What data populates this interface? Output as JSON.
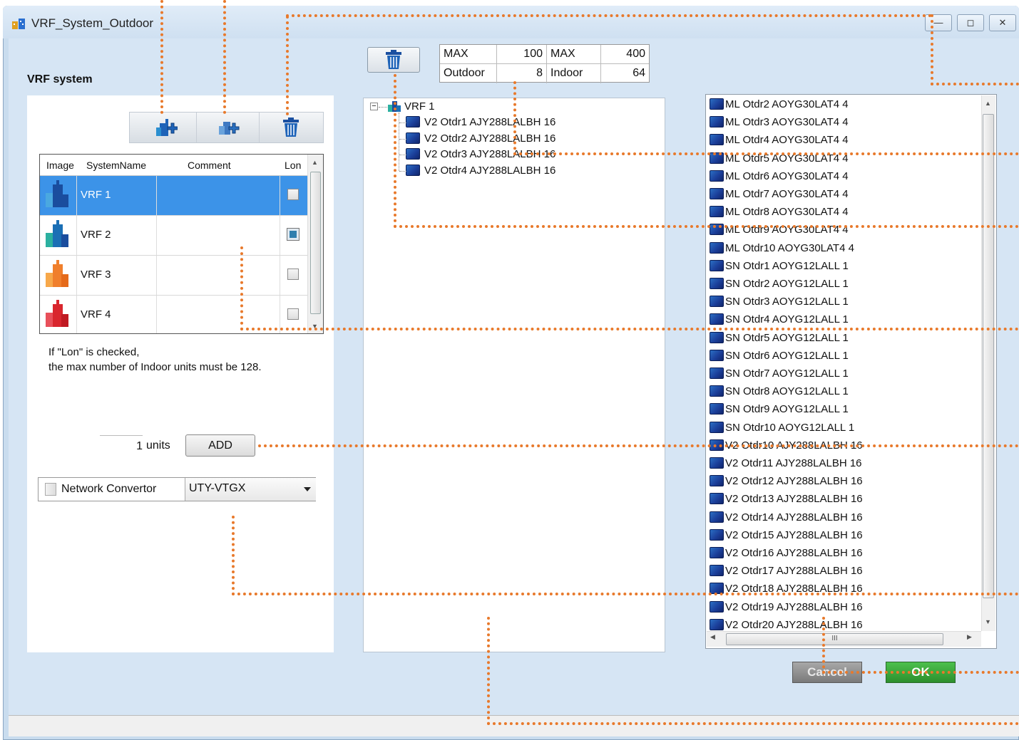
{
  "window": {
    "title": "VRF_System_Outdoor",
    "min_label": "—",
    "max_label": "◻",
    "close_label": "✕"
  },
  "left": {
    "section_label": "VRF system",
    "grid": {
      "headers": [
        "Image",
        "SystemName",
        "Comment",
        "Lon"
      ],
      "rows": [
        {
          "name": "VRF 1",
          "color": "#1a4d9e",
          "checked": false,
          "selected": true
        },
        {
          "name": "VRF 2",
          "color": "#1b6fb5",
          "checked": true,
          "selected": false
        },
        {
          "name": "VRF 3",
          "color": "#f07f2c",
          "checked": false,
          "selected": false
        },
        {
          "name": "VRF 4",
          "color": "#d9262e",
          "checked": false,
          "selected": false
        }
      ]
    },
    "note_line1": "If \"Lon\" is checked,",
    "note_line2": "the max number of Indoor units must be 128.",
    "units_value": "1",
    "units_label": "units",
    "add_label": "ADD",
    "network_label": "Network Convertor",
    "network_value": "UTY-VTGX"
  },
  "max_table": {
    "max1": "MAX",
    "max1_value": "100",
    "max2": "MAX",
    "max2_value": "400",
    "outdoor": "Outdoor",
    "outdoor_value": "8",
    "indoor": "Indoor",
    "indoor_value": "64"
  },
  "tree": {
    "root": "VRF 1",
    "children": [
      "V2  Otdr1  AJY288LALBH  16",
      "V2  Otdr2  AJY288LALBH  16",
      "V2  Otdr3  AJY288LALBH  16",
      "V2  Otdr4  AJY288LALBH  16"
    ]
  },
  "unit_list": [
    "ML  Otdr2  AOYG30LAT4  4",
    "ML  Otdr3  AOYG30LAT4  4",
    "ML  Otdr4  AOYG30LAT4  4",
    "ML  Otdr5  AOYG30LAT4  4",
    "ML  Otdr6  AOYG30LAT4  4",
    "ML  Otdr7  AOYG30LAT4  4",
    "ML  Otdr8  AOYG30LAT4  4",
    "ML  Otdr9  AOYG30LAT4  4",
    "ML  Otdr10  AOYG30LAT4  4",
    "SN  Otdr1  AOYG12LALL  1",
    "SN  Otdr2  AOYG12LALL  1",
    "SN  Otdr3  AOYG12LALL  1",
    "SN  Otdr4  AOYG12LALL  1",
    "SN  Otdr5  AOYG12LALL  1",
    "SN  Otdr6  AOYG12LALL  1",
    "SN  Otdr7  AOYG12LALL  1",
    "SN  Otdr8  AOYG12LALL  1",
    "SN  Otdr9  AOYG12LALL  1",
    "SN  Otdr10  AOYG12LALL  1",
    "V2  Otdr10  AJY288LALBH  16",
    "V2  Otdr11  AJY288LALBH  16",
    "V2  Otdr12  AJY288LALBH  16",
    "V2  Otdr13  AJY288LALBH  16",
    "V2  Otdr14  AJY288LALBH  16",
    "V2  Otdr15  AJY288LALBH  16",
    "V2  Otdr16  AJY288LALBH  16",
    "V2  Otdr17  AJY288LALBH  16",
    "V2  Otdr18  AJY288LALBH  16",
    "V2  Otdr19  AJY288LALBH  16",
    "V2  Otdr20  AJY288LALBH  16"
  ],
  "buttons": {
    "cancel": "Cancel",
    "ok": "OK"
  },
  "colors": {
    "annotation": "#e8792b",
    "selected_row": "#3c93e8",
    "ok": "#2d8f2d"
  }
}
